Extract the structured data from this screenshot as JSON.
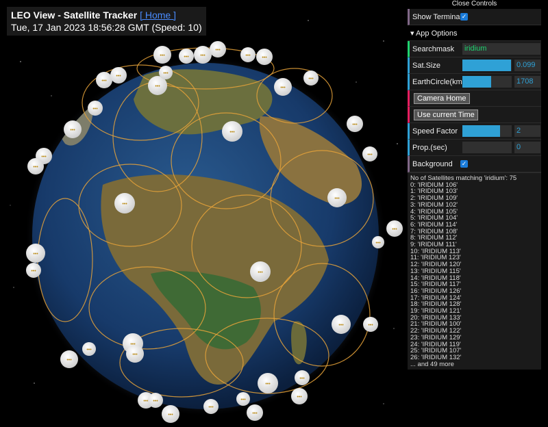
{
  "header": {
    "title": "LEO View - Satellite Tracker",
    "home_link": "[ Home ]",
    "datetime": "Tue, 17 Jan 2023 18:56:28 GMT (Speed: 10)"
  },
  "controls": {
    "close_label": "Close Controls",
    "show_terminal_label": "Show Terminal",
    "show_terminal_checked": true,
    "app_options_label": "▾ App Options",
    "searchmask_label": "Searchmask",
    "searchmask_value": "iridium",
    "sat_size_label": "Sat.Size",
    "sat_size_value": "0.099",
    "sat_size_fraction": 0.98,
    "earth_circle_label": "EarthCircle(km)",
    "earth_circle_value": "1708",
    "earth_circle_fraction": 0.58,
    "camera_home_label": "Camera Home",
    "current_time_label": "Use current Time",
    "speed_factor_label": "Speed Factor",
    "speed_factor_value": "2",
    "speed_factor_fraction": 0.76,
    "prop_label": "Prop.(sec)",
    "prop_value": "0",
    "prop_fraction": 0,
    "background_label": "Background",
    "background_checked": true
  },
  "terminal": {
    "summary": "No of Satellites matching 'iridium': 75",
    "items": [
      "0: 'IRIDIUM 106'",
      "1: 'IRIDIUM 103'",
      "2: 'IRIDIUM 109'",
      "3: 'IRIDIUM 102'",
      "4: 'IRIDIUM 105'",
      "5: 'IRIDIUM 104'",
      "6: 'IRIDIUM 114'",
      "7: 'IRIDIUM 108'",
      "8: 'IRIDIUM 112'",
      "9: 'IRIDIUM 111'",
      "10: 'IRIDIUM 113'",
      "11: 'IRIDIUM 123'",
      "12: 'IRIDIUM 120'",
      "13: 'IRIDIUM 115'",
      "14: 'IRIDIUM 118'",
      "15: 'IRIDIUM 117'",
      "16: 'IRIDIUM 126'",
      "17: 'IRIDIUM 124'",
      "18: 'IRIDIUM 128'",
      "19: 'IRIDIUM 121'",
      "20: 'IRIDIUM 133'",
      "21: 'IRIDIUM 100'",
      "22: 'IRIDIUM 122'",
      "23: 'IRIDIUM 129'",
      "24: 'IRIDIUM 119'",
      "25: 'IRIDIUM 107'",
      "26: 'IRIDIUM 132'"
    ],
    "more": "... and 49 more"
  },
  "colors": {
    "orbit": "#e8a33a",
    "ocean": "#173a6a",
    "land": "#6b6a3a",
    "accent": "#2fa1d6"
  }
}
